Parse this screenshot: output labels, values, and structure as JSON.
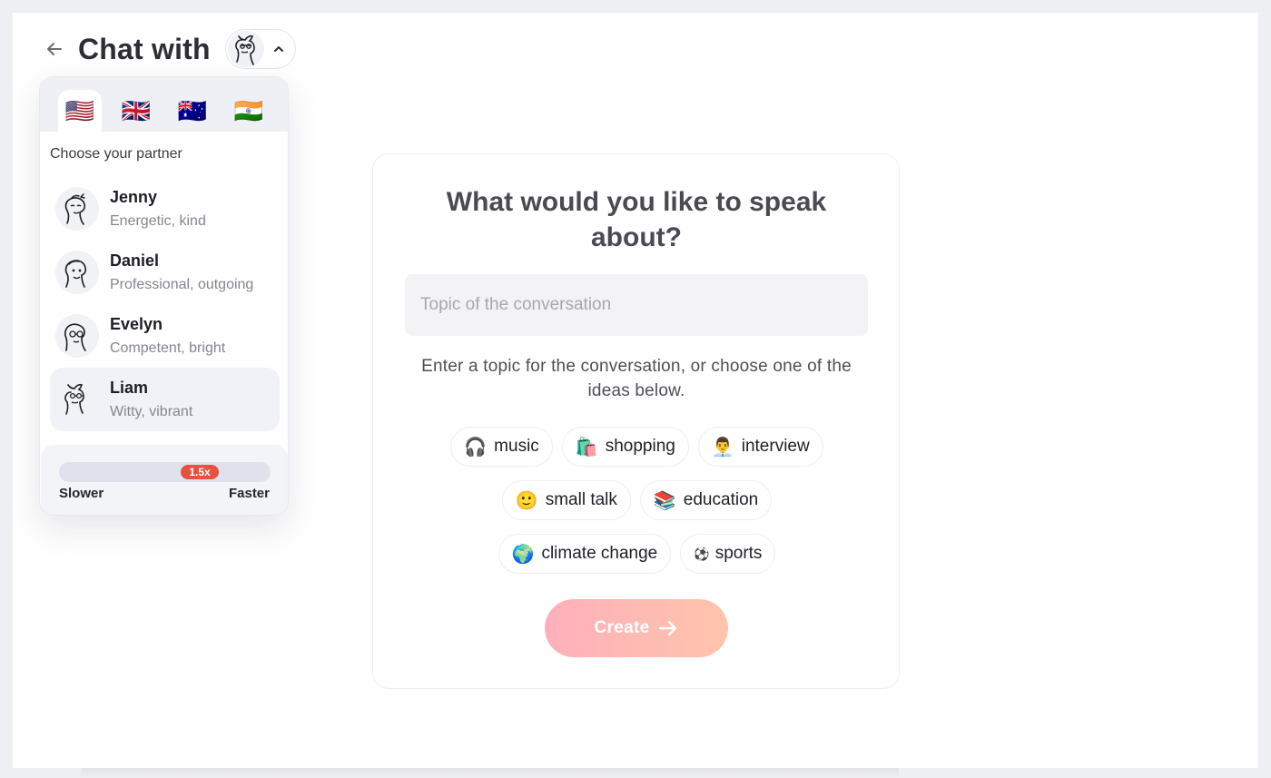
{
  "header": {
    "title": "Chat with",
    "back_icon": "arrow-left-icon",
    "selected_partner_icon": "liam-avatar-icon",
    "toggle_icon": "chevron-up-icon"
  },
  "partner_menu": {
    "flags": [
      {
        "emoji": "🇺🇸",
        "icon": "us-flag-icon",
        "active": true
      },
      {
        "emoji": "🇬🇧",
        "icon": "uk-flag-icon",
        "active": false
      },
      {
        "emoji": "🇦🇺",
        "icon": "australia-flag-icon",
        "active": false
      },
      {
        "emoji": "🇮🇳",
        "icon": "india-flag-icon",
        "active": false
      }
    ],
    "choose_label": "Choose your partner",
    "partners": [
      {
        "name": "Jenny",
        "desc": "Energetic, kind",
        "selected": false
      },
      {
        "name": "Daniel",
        "desc": "Professional, outgoing",
        "selected": false
      },
      {
        "name": "Evelyn",
        "desc": "Competent, bright",
        "selected": false
      },
      {
        "name": "Liam",
        "desc": "Witty, vibrant",
        "selected": true
      }
    ],
    "speed": {
      "value_label": "1.5x",
      "value_fraction": 0.65,
      "min_label": "Slower",
      "max_label": "Faster"
    }
  },
  "topic_card": {
    "title": "What would you like to speak about?",
    "input_placeholder": "Topic of the conversation",
    "input_value": "",
    "hint": "Enter a topic for the conversation, or choose one of the ideas below.",
    "chips": [
      {
        "emoji": "🎧",
        "label": "music"
      },
      {
        "emoji": "🛍️",
        "label": "shopping"
      },
      {
        "emoji": "👨‍💼",
        "label": "interview"
      },
      {
        "emoji": "🙂",
        "label": "small talk"
      },
      {
        "emoji": "📚",
        "label": "education"
      },
      {
        "emoji": "🌍",
        "label": "climate change"
      },
      {
        "emoji": "⚽",
        "label": "sports"
      }
    ],
    "create_label": "Create",
    "create_icon": "arrow-right-icon"
  },
  "colors": {
    "accent_red": "#e5533f",
    "create_gradient_start": "#ffb0bb",
    "create_gradient_end": "#ffc4ac",
    "selected_row_bg": "#f1f2f7"
  }
}
